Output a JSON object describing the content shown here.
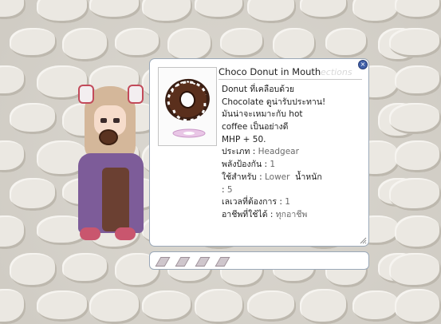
{
  "item": {
    "title": "Choco Donut in Mouth",
    "watermark": "ections",
    "description_lines": [
      "Donut ที่เคลือบด้วย",
      "Chocolate ดูน่ารับประทาน!",
      "มันน่าจะเหมาะกับ hot",
      "coffee เป็นอย่างดี",
      "MHP + 50."
    ],
    "type_label": "ประเภท : ",
    "type_value": "Headgear",
    "defense_label": "พลังป้องกัน : ",
    "defense_value": "1",
    "usable_label": "ใช้สำหรับ : ",
    "usable_value": "Lower",
    "weight_label": "น้ำหนัก",
    "weight_colon": ":",
    "weight_value": "5",
    "level_label": "เลเวลที่ต้องการ : ",
    "level_value": "1",
    "job_label": "อาชีพที่ใช้ได้ : ",
    "job_value": "ทุกอาชีพ",
    "close_icon": "close-icon",
    "image_icon": "choco-donut-icon"
  },
  "slots": {
    "count": 4
  },
  "colors": {
    "window_border": "#9aa8b8",
    "value_gray": "#6a6a6a",
    "close_blue": "#3f5fa8"
  }
}
